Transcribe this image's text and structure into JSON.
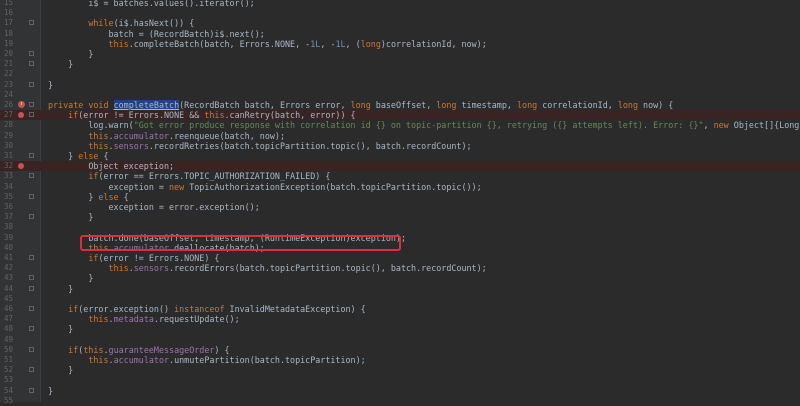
{
  "editor": {
    "lines": [
      {
        "num": "15",
        "text": "        i$ = batches.values().iterator();"
      },
      {
        "num": "16",
        "text": ""
      },
      {
        "num": "17",
        "text": "        while(i$.hasNext()) {"
      },
      {
        "num": "18",
        "text": "            batch = (RecordBatch)i$.next();"
      },
      {
        "num": "19",
        "text": "            this.completeBatch(batch, Errors.NONE, -1L, -1L, (long)correlationId, now);"
      },
      {
        "num": "20",
        "text": "        }"
      },
      {
        "num": "21",
        "text": "    }"
      },
      {
        "num": "22",
        "text": ""
      },
      {
        "num": "23",
        "text": "}"
      },
      {
        "num": "24",
        "text": ""
      },
      {
        "num": "26",
        "text": "private void completeBatch(RecordBatch batch, Errors error, long baseOffset, long timestamp, long correlationId, long now) {"
      },
      {
        "num": "27",
        "text": "    if(error != Errors.NONE && this.canRetry(batch, error)) {"
      },
      {
        "num": "28",
        "text": "        log.warn(\"Got error produce response with correlation id {} on topic-partition {}, retrying ({} attempts left). Error: {}\", new Object[]{Long.valueOf(corr"
      },
      {
        "num": "29",
        "text": "        this.accumulator.reenqueue(batch, now);"
      },
      {
        "num": "30",
        "text": "        this.sensors.recordRetries(batch.topicPartition.topic(), batch.recordCount);"
      },
      {
        "num": "31",
        "text": "    } else {"
      },
      {
        "num": "32",
        "text": "        Object exception;"
      },
      {
        "num": "33",
        "text": "        if(error == Errors.TOPIC_AUTHORIZATION_FAILED) {"
      },
      {
        "num": "34",
        "text": "            exception = new TopicAuthorizationException(batch.topicPartition.topic());"
      },
      {
        "num": "35",
        "text": "        } else {"
      },
      {
        "num": "36",
        "text": "            exception = error.exception();"
      },
      {
        "num": "37",
        "text": "        }"
      },
      {
        "num": "38",
        "text": ""
      },
      {
        "num": "39",
        "text": "        batch.done(baseOffset, timestamp, (RuntimeException)exception);"
      },
      {
        "num": "40",
        "text": "        this.accumulator.deallocate(batch);"
      },
      {
        "num": "41",
        "text": "        if(error != Errors.NONE) {"
      },
      {
        "num": "42",
        "text": "            this.sensors.recordErrors(batch.topicPartition.topic(), batch.recordCount);"
      },
      {
        "num": "43",
        "text": "        }"
      },
      {
        "num": "44",
        "text": "    }"
      },
      {
        "num": "45",
        "text": ""
      },
      {
        "num": "46",
        "text": "    if(error.exception() instanceof InvalidMetadataException) {"
      },
      {
        "num": "47",
        "text": "        this.metadata.requestUpdate();"
      },
      {
        "num": "48",
        "text": "    }"
      },
      {
        "num": "49",
        "text": ""
      },
      {
        "num": "50",
        "text": "    if(this.guaranteeMessageOrder) {"
      },
      {
        "num": "51",
        "text": "        this.accumulator.unmutePartition(batch.topicPartition);"
      },
      {
        "num": "52",
        "text": "    }"
      },
      {
        "num": "53",
        "text": ""
      },
      {
        "num": "54",
        "text": "}"
      },
      {
        "num": "55",
        "text": ""
      }
    ],
    "breakpoint_lines": [
      "27",
      "32"
    ],
    "override_lines": [
      "26"
    ],
    "highlighted_line": "39",
    "selected_identifier": "completeBatch",
    "colors": {
      "background": "#2b2b2b",
      "keyword": "#cc7832",
      "field": "#9876aa",
      "number": "#6897bb",
      "string": "#6a8759",
      "breakpoint": "#c75450",
      "highlight_box": "#d7313b"
    }
  }
}
